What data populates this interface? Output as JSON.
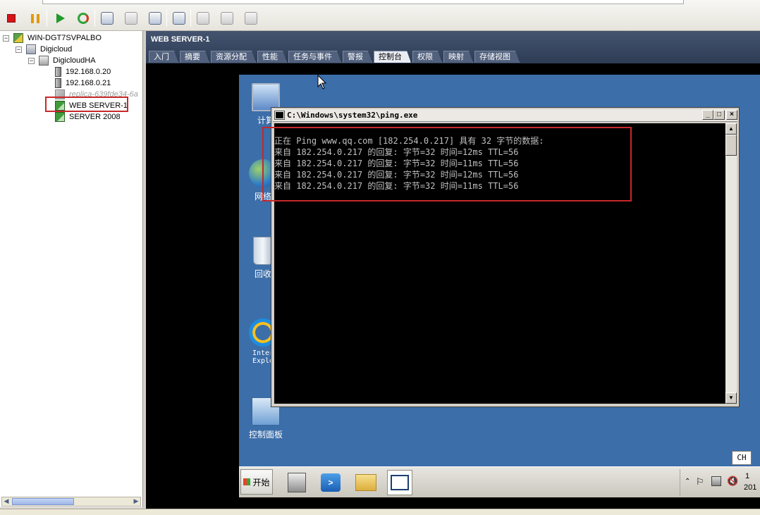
{
  "toolbar": {
    "icons": [
      "stop-icon",
      "pause-icon",
      "play-icon",
      "reset-icon",
      "snapshot-icon",
      "revert-snapshot-icon",
      "snapshot-manager-icon",
      "console-icon",
      "edit-settings-icon",
      "migrate-icon",
      "clone-icon"
    ]
  },
  "tree": {
    "host": "WIN-DGT7SVPALBO",
    "datacenter": "Digicloud",
    "cluster": "DigicloudHA",
    "hosts": [
      "192.168.0.20",
      "192.168.0.21"
    ],
    "ghost_item": "replica-639fde34-6a",
    "vms": [
      "WEB SERVER-1",
      "SERVER 2008"
    ]
  },
  "panel": {
    "title": "WEB SERVER-1",
    "tabs": [
      "入门",
      "摘要",
      "资源分配",
      "性能",
      "任务与事件",
      "警报",
      "控制台",
      "权限",
      "映射",
      "存储视图"
    ],
    "active_tab": "控制台"
  },
  "desktop": {
    "icons": [
      {
        "label": "计算",
        "icon": "computer-icon"
      },
      {
        "label": "网络",
        "icon": "network-icon"
      },
      {
        "label": "回收",
        "icon": "recycle-bin-icon"
      },
      {
        "label": "Inter\nExplo",
        "icon": "ie-icon"
      },
      {
        "label": "控制面板",
        "icon": "control-panel-icon"
      }
    ]
  },
  "cmd": {
    "title": "C:\\Windows\\system32\\ping.exe",
    "lines": [
      "正在 Ping www.qq.com [182.254.0.217] 具有 32 字节的数据:",
      "来自 182.254.0.217 的回复: 字节=32 时间=12ms TTL=56",
      "来自 182.254.0.217 的回复: 字节=32 时间=11ms TTL=56",
      "来自 182.254.0.217 的回复: 字节=32 时间=12ms TTL=56",
      "来自 182.254.0.217 的回复: 字节=32 时间=11ms TTL=56"
    ]
  },
  "taskbar": {
    "start_label": "开始",
    "lang": "CH",
    "clock_line1": "1",
    "clock_line2": "201"
  },
  "colors": {
    "accent_red": "#c8282b",
    "desktop_blue": "#3c6ea9",
    "panel_header": "#3a4962"
  }
}
